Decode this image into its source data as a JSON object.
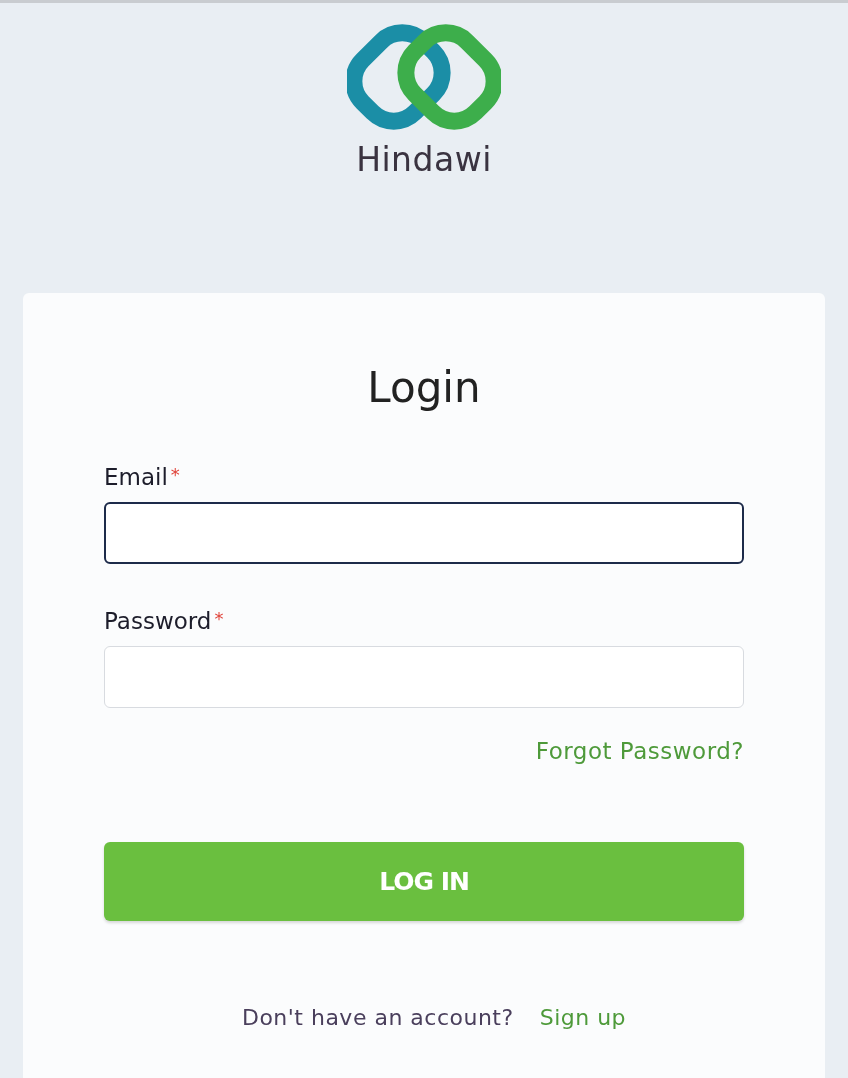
{
  "brand": {
    "name": "Hindawi"
  },
  "login": {
    "title": "Login",
    "fields": [
      {
        "label": "Email",
        "marker": "*",
        "focused": true
      },
      {
        "label": "Password",
        "marker": "*",
        "focused": false
      }
    ],
    "forgot_link": "Forgot Password?",
    "submit_button": "LOG IN",
    "signup_prompt": "Don't have an account?",
    "signup_link": "Sign up"
  }
}
